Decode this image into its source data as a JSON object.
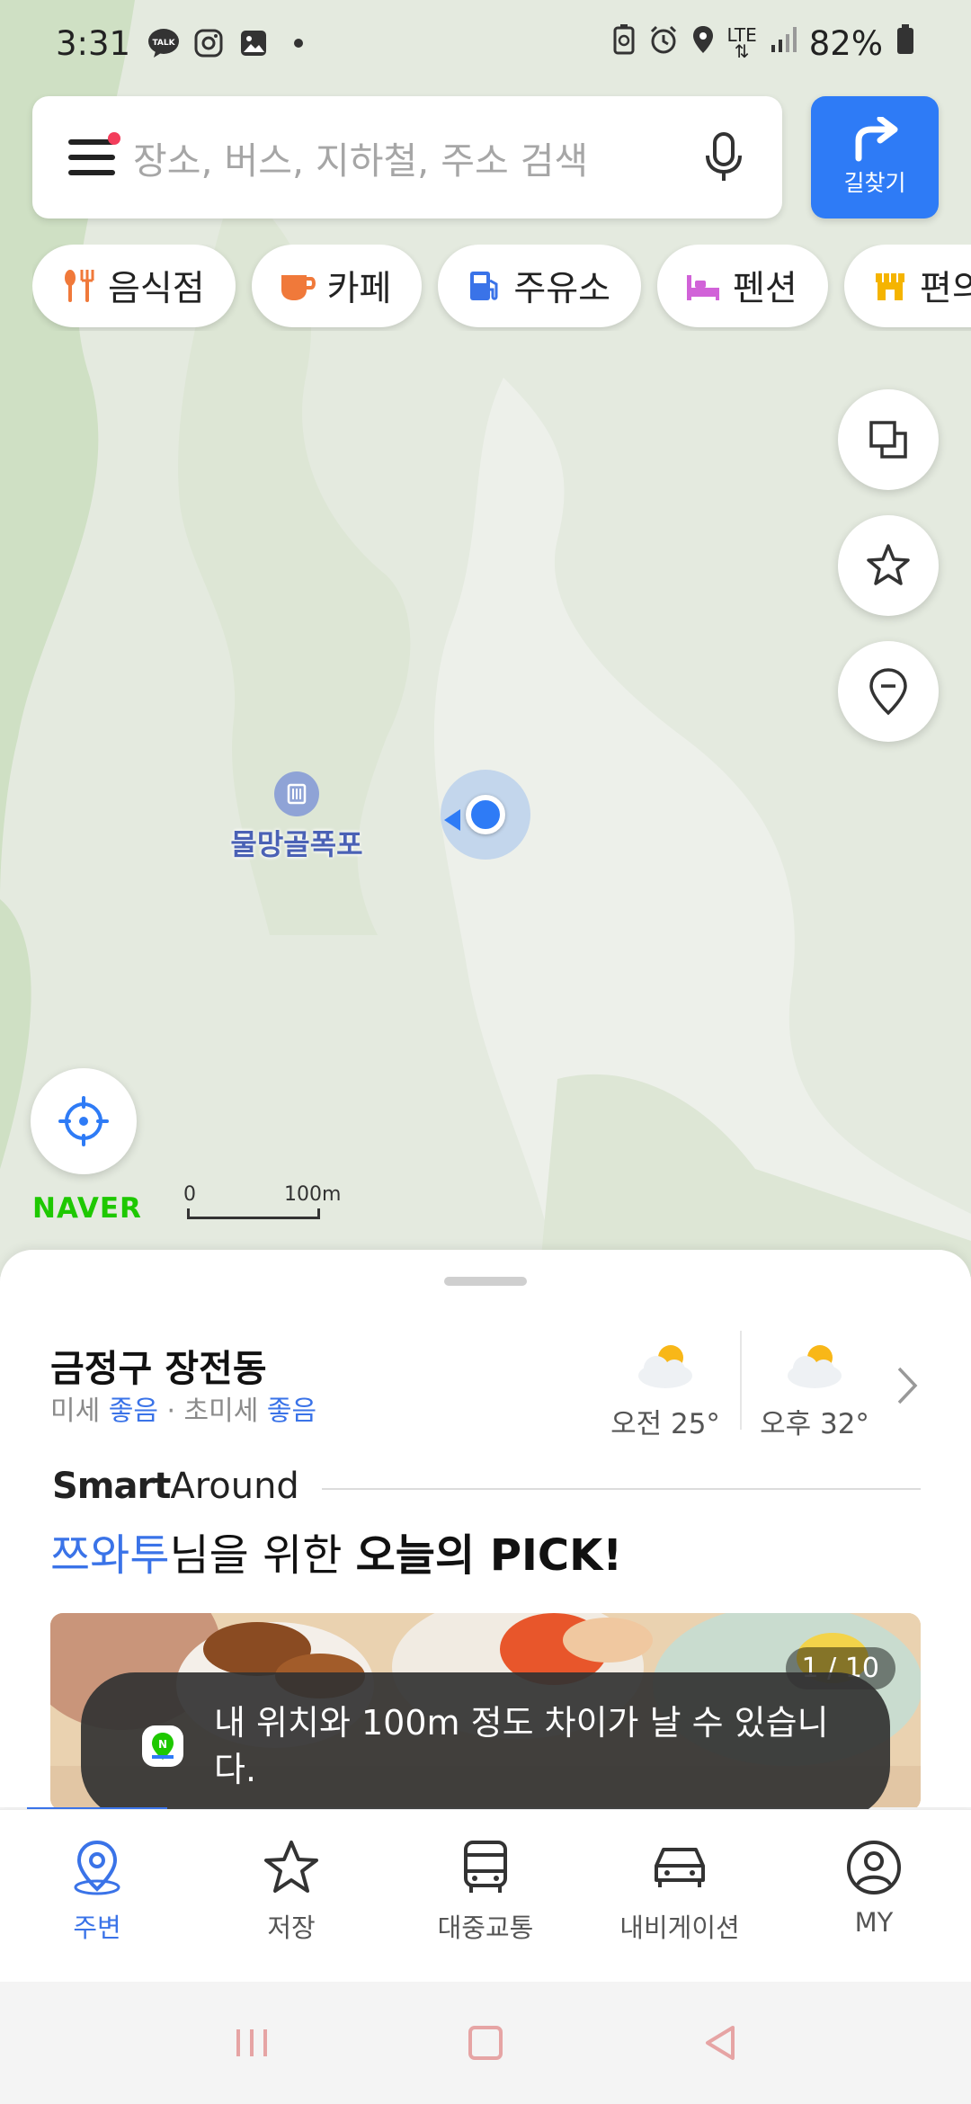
{
  "status_bar": {
    "time": "3:31",
    "network": "LTE",
    "battery": "82%",
    "icons": [
      "kakaotalk-icon",
      "instagram-icon",
      "gallery-icon",
      "dot-icon",
      "battery-saver-icon",
      "alarm-icon",
      "location-icon",
      "lte-icon",
      "signal-icon",
      "battery-icon"
    ]
  },
  "search": {
    "placeholder": "장소, 버스, 지하철, 주소 검색",
    "route_label": "길찾기"
  },
  "categories": [
    {
      "label": "음식점",
      "icon": "restaurant-icon",
      "color": "#f0793a"
    },
    {
      "label": "카페",
      "icon": "coffee-icon",
      "color": "#f0793a"
    },
    {
      "label": "주유소",
      "icon": "gas-station-icon",
      "color": "#3a73e8"
    },
    {
      "label": "펜션",
      "icon": "bed-icon",
      "color": "#d162d8"
    },
    {
      "label": "편의",
      "icon": "store-icon",
      "color": "#f5b400"
    }
  ],
  "map": {
    "poi_name": "물망골폭포",
    "brand": "NAVER",
    "scale_zero": "0",
    "scale_distance": "100m"
  },
  "sheet": {
    "location": "금정구 장전동",
    "air_prefix": "미세 ",
    "air_fine": "좋음",
    "air_mid": " · 초미세 ",
    "air_ultra": "좋음",
    "weather": [
      {
        "label": "오전 25°",
        "icon": "partly-cloudy-icon"
      },
      {
        "label": "오후 32°",
        "icon": "partly-cloudy-icon"
      }
    ],
    "smart_bold": "Smart",
    "smart_rest": "Around",
    "pick_user": "쯔와투",
    "pick_mid": "님을 위한 ",
    "pick_bold": "오늘의 PICK!",
    "photo_counter": "1 / 10"
  },
  "toast": {
    "message": "내 위치와 100m 정도 차이가 날 수 있습니다."
  },
  "tabs": [
    {
      "label": "주변",
      "icon": "nearby-pin-icon",
      "active": true
    },
    {
      "label": "저장",
      "icon": "star-icon",
      "active": false
    },
    {
      "label": "대중교통",
      "icon": "bus-icon",
      "active": false
    },
    {
      "label": "내비게이션",
      "icon": "car-icon",
      "active": false
    },
    {
      "label": "MY",
      "icon": "profile-icon",
      "active": false
    }
  ],
  "colors": {
    "accent": "#3a73e8",
    "route_button": "#2e7bf6",
    "naver_green": "#1ec800",
    "map_land": "#e4eadf"
  }
}
